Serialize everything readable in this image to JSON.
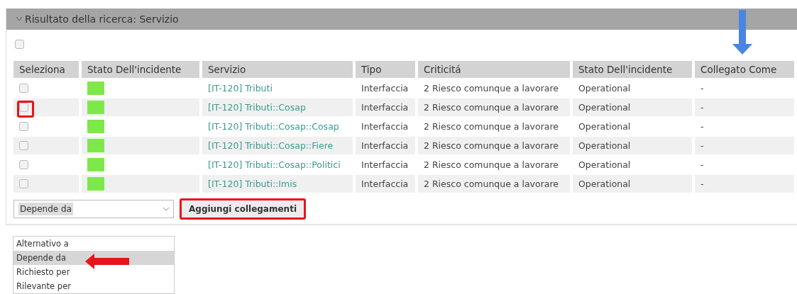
{
  "panel": {
    "title": "Risultato della ricerca: Servizio",
    "expanded": true
  },
  "select_all": {
    "checked": false
  },
  "table": {
    "columns": [
      {
        "label": "Seleziona"
      },
      {
        "label": "Stato Dell'incidente"
      },
      {
        "label": "Servizio"
      },
      {
        "label": "Tipo"
      },
      {
        "label": "Criticitá"
      },
      {
        "label": "Stato Dell'incidente"
      },
      {
        "label": "Collegato Come"
      }
    ],
    "rows": [
      {
        "checked": false,
        "highlighted": false,
        "color": "#7ee84a",
        "service": "[IT-120] Tributi",
        "type": "Interfaccia",
        "criticality": "2 Riesco comunque a lavorare",
        "status": "Operational",
        "linked_as": "-"
      },
      {
        "checked": false,
        "highlighted": true,
        "color": "#7ee84a",
        "service": "[IT-120] Tributi::Cosap",
        "type": "Interfaccia",
        "criticality": "2 Riesco comunque a lavorare",
        "status": "Operational",
        "linked_as": "-"
      },
      {
        "checked": false,
        "highlighted": false,
        "color": "#7ee84a",
        "service": "[IT-120] Tributi::Cosap::Cosap",
        "type": "Interfaccia",
        "criticality": "2 Riesco comunque a lavorare",
        "status": "Operational",
        "linked_as": "-"
      },
      {
        "checked": false,
        "highlighted": false,
        "color": "#7ee84a",
        "service": "[IT-120] Tributi::Cosap::Fiere",
        "type": "Interfaccia",
        "criticality": "2 Riesco comunque a lavorare",
        "status": "Operational",
        "linked_as": "-"
      },
      {
        "checked": false,
        "highlighted": false,
        "color": "#7ee84a",
        "service": "[IT-120] Tributi::Cosap::Politici",
        "type": "Interfaccia",
        "criticality": "2 Riesco comunque a lavorare",
        "status": "Operational",
        "linked_as": "-"
      },
      {
        "checked": false,
        "highlighted": false,
        "color": "#7ee84a",
        "service": "[IT-120] Tributi::Imis",
        "type": "Interfaccia",
        "criticality": "2 Riesco comunque a lavorare",
        "status": "Operational",
        "linked_as": "-"
      }
    ]
  },
  "link_type": {
    "value": "Depende da",
    "expanded": true,
    "options": [
      {
        "label": "Alternativo a",
        "selected": false
      },
      {
        "label": "Depende da",
        "selected": true
      },
      {
        "label": "Richiesto per",
        "selected": false
      },
      {
        "label": "Rilevante per",
        "selected": false
      }
    ]
  },
  "add_button": {
    "label": "Aggiungi collegamenti",
    "highlighted": true
  },
  "annotation_arrows": [
    {
      "kind": "down",
      "color": "#4a86e0"
    },
    {
      "kind": "left",
      "color": "#e8141a"
    }
  ]
}
